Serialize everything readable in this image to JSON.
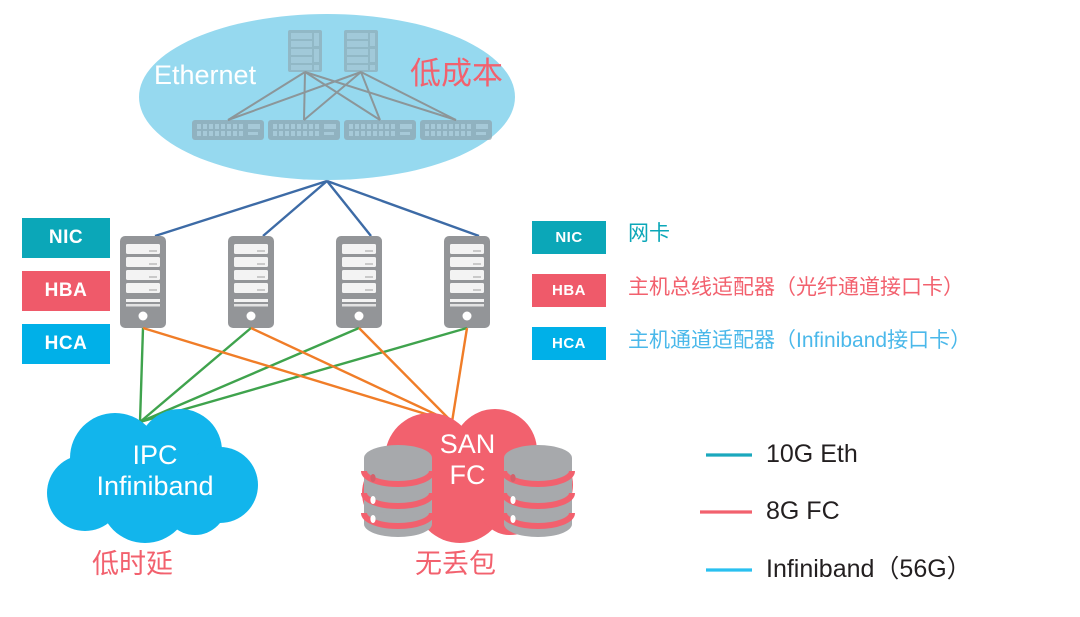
{
  "colors": {
    "ethernet_cloud": "#96d9ef",
    "ethernet_label": "#ffffff",
    "red_accent": "#f2616e",
    "nic_teal": "#0ba7b8",
    "hba_red": "#ef5a6a",
    "hca_blue": "#00b0e8",
    "ipc_cloud": "#12b5ec",
    "san_cloud": "#f2616e",
    "server_gray": "#939598",
    "switch_gray": "#8a9aa3",
    "eth_line": "#3d6ba6",
    "ib_line": "#3fa34d",
    "fc_line": "#f07d28",
    "storage_gray": "#a7a9ac",
    "legend_text": "#231f20"
  },
  "ethernet": {
    "label": "Ethernet",
    "cost_label": "低成本",
    "core_switches": 2,
    "access_switches": 4
  },
  "servers": {
    "count": 4
  },
  "adapters_left": [
    {
      "code": "NIC",
      "color": "#0ba7b8"
    },
    {
      "code": "HBA",
      "color": "#ef5a6a"
    },
    {
      "code": "HCA",
      "color": "#00b0e8"
    }
  ],
  "adapters_right": [
    {
      "code": "NIC",
      "color": "#0ba7b8",
      "desc": "网卡",
      "desc_color": "#0ba7b8"
    },
    {
      "code": "HBA",
      "color": "#ef5a6a",
      "desc": "主机总线适配器（光纤通道接口卡）",
      "desc_color": "#f2616e"
    },
    {
      "code": "HCA",
      "color": "#00b0e8",
      "desc": "主机通道适配器（Infiniband接口卡）",
      "desc_color": "#4ab8ea"
    }
  ],
  "clouds": [
    {
      "id": "ipc",
      "line1": "IPC",
      "line2": "Infiniband",
      "caption": "低时延",
      "color": "#12b5ec"
    },
    {
      "id": "san",
      "line1": "SAN",
      "line2": "FC",
      "caption": "无丢包",
      "color": "#f2616e"
    }
  ],
  "legend": [
    {
      "label": "10G Eth",
      "color": "#1aa8bd"
    },
    {
      "label": "8G FC",
      "color": "#f2616e"
    },
    {
      "label": "Infiniband（56G）",
      "color": "#29c0f0"
    }
  ]
}
